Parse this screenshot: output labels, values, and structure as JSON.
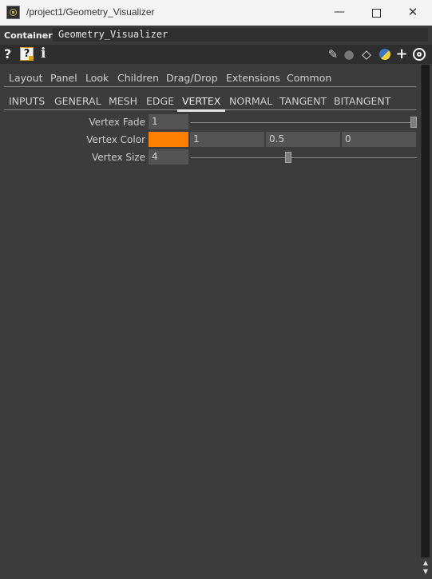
{
  "window": {
    "title": "/project1/Geometry_Visualizer",
    "min_glyph": "—",
    "close_glyph": "✕"
  },
  "header": {
    "type_label": "Container",
    "component_name": "Geometry_Visualizer"
  },
  "toolbar": {
    "help_glyph": "?",
    "operator_help_glyph": "?",
    "info_glyph": "i",
    "pencil_glyph": "✎",
    "comment_glyph": "●",
    "clone_glyph": "◇",
    "add_glyph": "+"
  },
  "page_tabs": [
    "Layout",
    "Panel",
    "Look",
    "Children",
    "Drag/Drop",
    "Extensions",
    "Common"
  ],
  "sub_tabs": [
    "INPUTS",
    "GENERAL",
    "MESH",
    "EDGE",
    "VERTEX",
    "NORMAL",
    "TANGENT",
    "BITANGENT"
  ],
  "active_sub_tab": "VERTEX",
  "params": {
    "vertex_fade": {
      "label": "Vertex Fade",
      "value": "1",
      "slider_fraction": 1.0
    },
    "vertex_color": {
      "label": "Vertex Color",
      "swatch": "#ff7f00",
      "r": "1",
      "g": "0.5",
      "b": "0"
    },
    "vertex_size": {
      "label": "Vertex Size",
      "value": "4",
      "slider_fraction": 0.43
    }
  },
  "scrollbar": {
    "up_glyph": "▲",
    "down_glyph": "▼"
  }
}
